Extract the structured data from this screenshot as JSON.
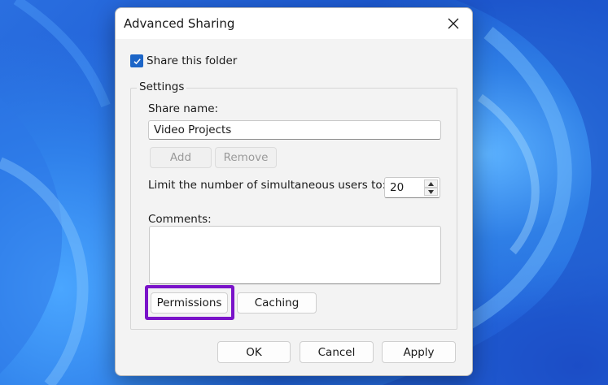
{
  "dialog": {
    "title": "Advanced Sharing"
  },
  "share_folder": {
    "label": "Share this folder",
    "checked": true
  },
  "settings": {
    "group_label": "Settings",
    "share_name_label": "Share name:",
    "share_name_value": "Video Projects",
    "add_label": "Add",
    "remove_label": "Remove",
    "limit_label": "Limit the number of simultaneous users to:",
    "limit_value": "20",
    "comments_label": "Comments:",
    "comments_value": "",
    "permissions_label": "Permissions",
    "caching_label": "Caching"
  },
  "footer": {
    "ok_label": "OK",
    "cancel_label": "Cancel",
    "apply_label": "Apply"
  },
  "colors": {
    "highlight": "#7a13c9",
    "checkbox_accent": "#1c65c7",
    "desktop_blue": "#1f5fd6"
  },
  "icons": {
    "close": "close-icon",
    "check": "checkmark-icon",
    "spin_up": "chevron-up-icon",
    "spin_down": "chevron-down-icon"
  }
}
